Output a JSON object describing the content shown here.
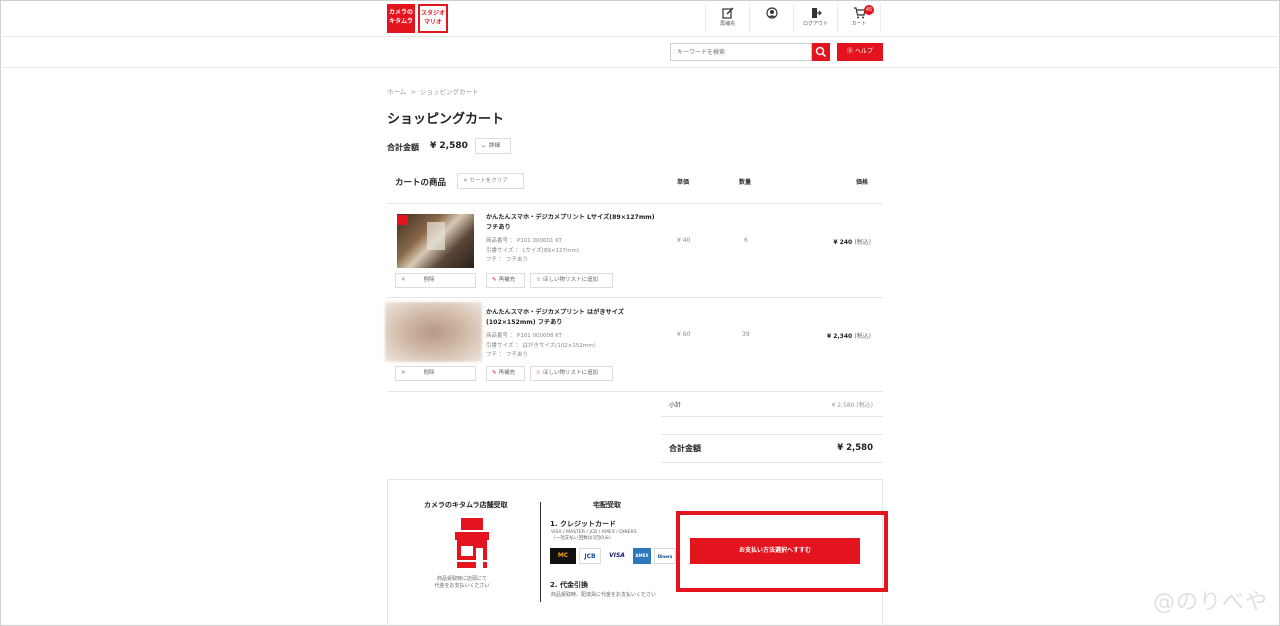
{
  "header": {
    "logo_kitamura": "カメラのキタムラ",
    "logo_studio": "スタジオマリオ",
    "nav": [
      {
        "label": "再補充",
        "icon": "edit-icon"
      },
      {
        "label": "",
        "icon": "user-icon"
      },
      {
        "label": "ログアウト",
        "icon": "logout-icon"
      },
      {
        "label": "カート",
        "icon": "cart-icon",
        "badge": "45"
      }
    ],
    "search_placeholder": "キーワードを検索",
    "help_label": "ヘルプ"
  },
  "breadcrumb": {
    "home": "ホーム",
    "sep": ">",
    "current": "ショッピングカート"
  },
  "page_title": "ショッピングカート",
  "total": {
    "label": "合計金額",
    "value": "¥ 2,580",
    "detail_label": "詳細"
  },
  "cart": {
    "label": "カートの商品",
    "clear_label": "カートをクリア",
    "columns": {
      "unit": "単価",
      "qty": "数量",
      "price": "価格"
    },
    "items": [
      {
        "name": "かんたんスマホ・デジカメプリント Lサイズ(89×127mm) フチあり",
        "meta": [
          "商品番号 ： P101 000001 KT",
          "引書サイズ ： Lサイズ(89×127mm)",
          "フチ ： フチあり"
        ],
        "unit": "¥ 40",
        "qty": "6",
        "price": "¥ 240",
        "tax": "(税込)",
        "delete_label": "削除",
        "reedit_label": "再補充",
        "wishlist_label": "ほしい物リストに追加"
      },
      {
        "name": "かんたんスマホ・デジカメプリント はがきサイズ (102×152mm) フチあり",
        "meta": [
          "商品番号 ： P101 000008 KT",
          "引書サイズ ： はがきサイズ(102×152mm)",
          "フチ ： フチあり"
        ],
        "unit": "¥ 60",
        "qty": "39",
        "price": "¥ 2,340",
        "tax": "(税込)",
        "delete_label": "削除",
        "reedit_label": "再補充",
        "wishlist_label": "ほしい物リストに追加"
      }
    ],
    "subtotal_label": "小計",
    "subtotal_value": "¥ 2,580 (税込)",
    "sum_label": "合計金額",
    "sum_value": "¥ 2,580"
  },
  "delivery": {
    "store_title": "カメラのキタムラ店舗受取",
    "store_note_1": "商品受取時に店頭にて",
    "store_note_2": "代金をお支払いください",
    "home_title": "宅配受取",
    "method1": "1. クレジットカード",
    "method1_note_1": "VISA / MASTER / JCB / AMEX / DINERS",
    "method1_note_2": "（一括支払い回数は1回のみ）",
    "cards": [
      "MC",
      "JCB",
      "VISA",
      "AMEX",
      "Diners"
    ],
    "method2": "2. 代金引換",
    "method2_note": "商品受取時、配達員に代金をお支払いください",
    "pay_button": "お支払い方法選択へすすむ"
  },
  "watermark": "@のりべや",
  "colors": {
    "accent": "#e4141e"
  }
}
